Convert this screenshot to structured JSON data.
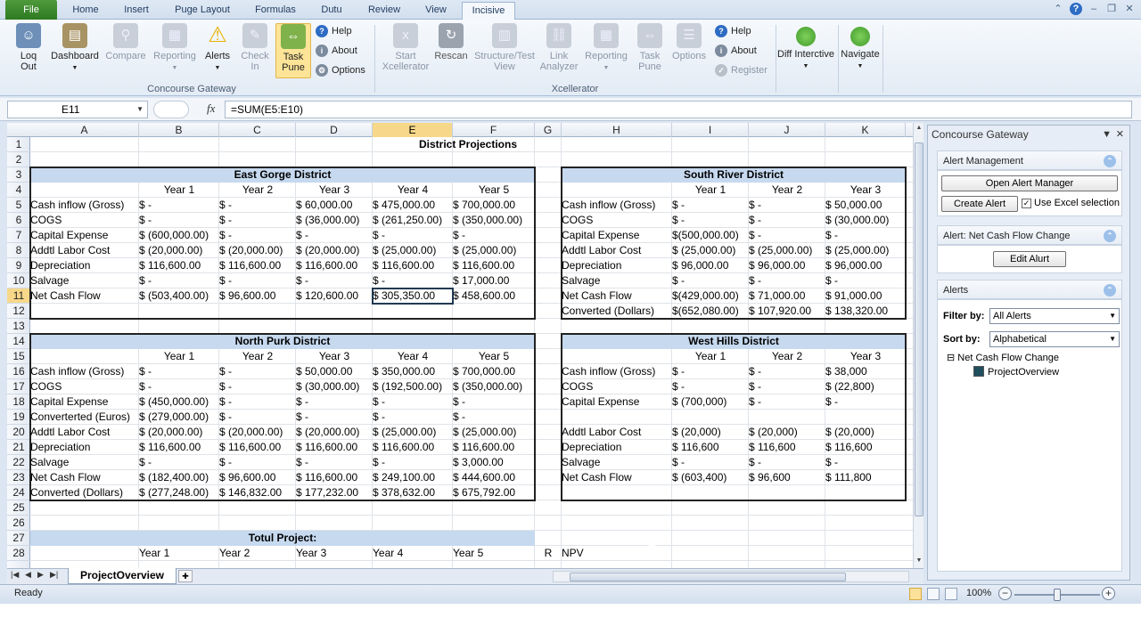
{
  "tabs": {
    "file": "File",
    "home": "Home",
    "insert": "Insert",
    "page_layout": "Puge Layout",
    "formulas": "Formulas",
    "data": "Dutu",
    "review": "Review",
    "view": "View",
    "incisive": "Incisive"
  },
  "ribbon": {
    "logout": "Loq Out",
    "dashboard": "Dashboard",
    "compare": "Compare",
    "reporting": "Reporting",
    "alerts": "Alerts",
    "check_in": "Check In",
    "task_pune": "Task Pune",
    "help": "Help",
    "about": "About",
    "options": "Options",
    "group1": "Concourse Gateway",
    "start_xcellerator": "Start Xcellerator",
    "rescan": "Rescan",
    "structure_test_view": "Structure/Test View",
    "link_analyzer": "Link Analyzer",
    "reporting2": "Reporting",
    "task_pune2": "Task Pune",
    "options2": "Options",
    "help2": "Help",
    "about2": "About",
    "register": "Register",
    "group2": "Xcellerator",
    "diff_interactive": "Diff Interctive",
    "navigate": "Navigate"
  },
  "formula_bar": {
    "name_box": "E11",
    "formula": "=SUM(E5:E10)"
  },
  "columns": [
    "A",
    "B",
    "C",
    "D",
    "E",
    "F",
    "G",
    "H",
    "I",
    "J",
    "K"
  ],
  "rows": [
    "1",
    "2",
    "3",
    "4",
    "5",
    "6",
    "7",
    "8",
    "9",
    "10",
    "11",
    "12",
    "13",
    "14",
    "15",
    "16",
    "17",
    "18",
    "19",
    "20",
    "21",
    "22",
    "23",
    "24",
    "25",
    "26",
    "27",
    "28"
  ],
  "sheet": {
    "title": "District Projections",
    "east": {
      "name": "East Gorge District",
      "years": [
        "Year 1",
        "Year 2",
        "Year 3",
        "Year 4",
        "Year 5"
      ],
      "rows": [
        {
          "label": "Cash inflow (Gross)",
          "v": [
            "$            -",
            "$            -",
            "$   60,000.00",
            "$  475,000.00",
            "$  700,000.00"
          ]
        },
        {
          "label": "COGS",
          "v": [
            "$            -",
            "$            -",
            "$  (36,000.00)",
            "$ (261,250.00)",
            "$ (350,000.00)"
          ]
        },
        {
          "label": "Capital Expense",
          "v": [
            "$ (600,000.00)",
            "$            -",
            "$            -",
            "$            -",
            "$            -"
          ]
        },
        {
          "label": "Addtl Labor Cost",
          "v": [
            "$  (20,000.00)",
            "$  (20,000.00)",
            "$  (20,000.00)",
            "$  (25,000.00)",
            "$  (25,000.00)"
          ]
        },
        {
          "label": "Depreciation",
          "v": [
            "$  116,600.00",
            "$ 116,600.00",
            "$ 116,600.00",
            "$  116,600.00",
            "$  116,600.00"
          ]
        },
        {
          "label": "Salvage",
          "v": [
            "$            -",
            "$            -",
            "$            -",
            "$            -",
            "$   17,000.00"
          ]
        },
        {
          "label": "Net Cash Flow",
          "v": [
            "$ (503,400.00)",
            "$  96,600.00",
            "$ 120,600.00",
            "$  305,350.00",
            "$  458,600.00"
          ]
        }
      ]
    },
    "south": {
      "name": "South River District",
      "years": [
        "Year 1",
        "Year 2",
        "Year 3"
      ],
      "rows": [
        {
          "label": "Cash inflow (Gross)",
          "v": [
            "$            -",
            "$            -",
            "$   50,000.00"
          ]
        },
        {
          "label": "COGS",
          "v": [
            "$            -",
            "$            -",
            "$  (30,000.00)"
          ]
        },
        {
          "label": "Capital Expense",
          "v": [
            "$(500,000.00)",
            "$            -",
            "$            -"
          ]
        },
        {
          "label": "Addtl Labor Cost",
          "v": [
            "$  (25,000.00)",
            "$  (25,000.00)",
            "$  (25,000.00)"
          ]
        },
        {
          "label": "Depreciation",
          "v": [
            "$   96,000.00",
            "$   96,000.00",
            "$   96,000.00"
          ]
        },
        {
          "label": "Salvage",
          "v": [
            "$            -",
            "$            -",
            "$            -"
          ]
        },
        {
          "label": "Net Cash Flow",
          "v": [
            "$(429,000.00)",
            "$  71,000.00",
            "$  91,000.00"
          ]
        },
        {
          "label": "Converted (Dollars)",
          "v": [
            "$(652,080.00)",
            "$ 107,920.00",
            "$ 138,320.00"
          ]
        }
      ]
    },
    "north": {
      "name": "North Purk District",
      "years": [
        "Year 1",
        "Year 2",
        "Year 3",
        "Year 4",
        "Year 5"
      ],
      "rows": [
        {
          "label": "Cash inflow (Gross)",
          "v": [
            "$            -",
            "$            -",
            "$   50,000.00",
            "$  350,000.00",
            "$  700,000.00"
          ]
        },
        {
          "label": "COGS",
          "v": [
            "$            -",
            "$            -",
            "$  (30,000.00)",
            "$ (192,500.00)",
            "$ (350,000.00)"
          ]
        },
        {
          "label": "Capital Expense",
          "v": [
            "$ (450,000.00)",
            "$            -",
            "$            -",
            "$            -",
            "$            -"
          ]
        },
        {
          "label": "Converterted (Euros)",
          "v": [
            "$ (279,000.00)",
            "$            -",
            "$            -",
            "$            -",
            "$            -"
          ]
        },
        {
          "label": "Addtl Labor Cost",
          "v": [
            "$  (20,000.00)",
            "$  (20,000.00)",
            "$  (20,000.00)",
            "$  (25,000.00)",
            "$  (25,000.00)"
          ]
        },
        {
          "label": "Depreciation",
          "v": [
            "$  116,600.00",
            "$ 116,600.00",
            "$ 116,600.00",
            "$  116,600.00",
            "$  116,600.00"
          ]
        },
        {
          "label": "Salvage",
          "v": [
            "$            -",
            "$            -",
            "$            -",
            "$            -",
            "$    3,000.00"
          ]
        },
        {
          "label": "Net Cash Flow",
          "v": [
            "$ (182,400.00)",
            "$  96,600.00",
            "$ 116,600.00",
            "$  249,100.00",
            "$  444,600.00"
          ]
        },
        {
          "label": "Converted (Dollars)",
          "v": [
            "$ (277,248.00)",
            "$ 146,832.00",
            "$ 177,232.00",
            "$  378,632.00",
            "$  675,792.00"
          ]
        }
      ]
    },
    "west": {
      "name": "West Hills District",
      "years": [
        "Year 1",
        "Year 2",
        "Year 3"
      ],
      "rows": [
        {
          "label": "Cash inflow (Gross)",
          "v": [
            "$          -",
            "$          -",
            "$     38,000"
          ]
        },
        {
          "label": "COGS",
          "v": [
            "$          -",
            "$          -",
            "$    (22,800)"
          ]
        },
        {
          "label": "Capital Expense",
          "v": [
            "$    (700,000)",
            "$          -",
            "$          -"
          ]
        },
        {
          "label": "",
          "v": [
            "",
            "",
            ""
          ]
        },
        {
          "label": "Addtl Labor Cost",
          "v": [
            "$     (20,000)",
            "$     (20,000)",
            "$     (20,000)"
          ]
        },
        {
          "label": "Depreciation",
          "v": [
            "$     116,600",
            "$     116,600",
            "$     116,600"
          ]
        },
        {
          "label": "Salvage",
          "v": [
            "$          -",
            "$          -",
            "$          -"
          ]
        },
        {
          "label": "Net Cash Flow",
          "v": [
            "$    (603,400)",
            "$      96,600",
            "$     111,800"
          ]
        }
      ]
    },
    "total": {
      "name": "Totul Project:",
      "years": [
        "Year 1",
        "Year 2",
        "Year 3",
        "Year 4",
        "Year 5"
      ],
      "r_label": "R",
      "npv_label": "NPV"
    }
  },
  "sheet_tab": "ProjectOverview",
  "status": "Ready",
  "zoom": "100%",
  "pane": {
    "title": "Concourse Gateway",
    "alert_mgmt": "Alert Management",
    "open_alert_manager": "Open Alert Manager",
    "create_alert": "Create Alert",
    "use_excel_selection": "Use Excel selection",
    "alert_section": "Alert: Net Cash Flow Change",
    "edit_alert": "Edit Alurt",
    "alerts": "Alerts",
    "filter_by": "Filter by:",
    "filter_value": "All Alerts",
    "sort_by": "Sort by:",
    "sort_value": "Alphabetical",
    "tree_root": "Net Cash Flow Change",
    "tree_child": "ProjectOverview"
  }
}
